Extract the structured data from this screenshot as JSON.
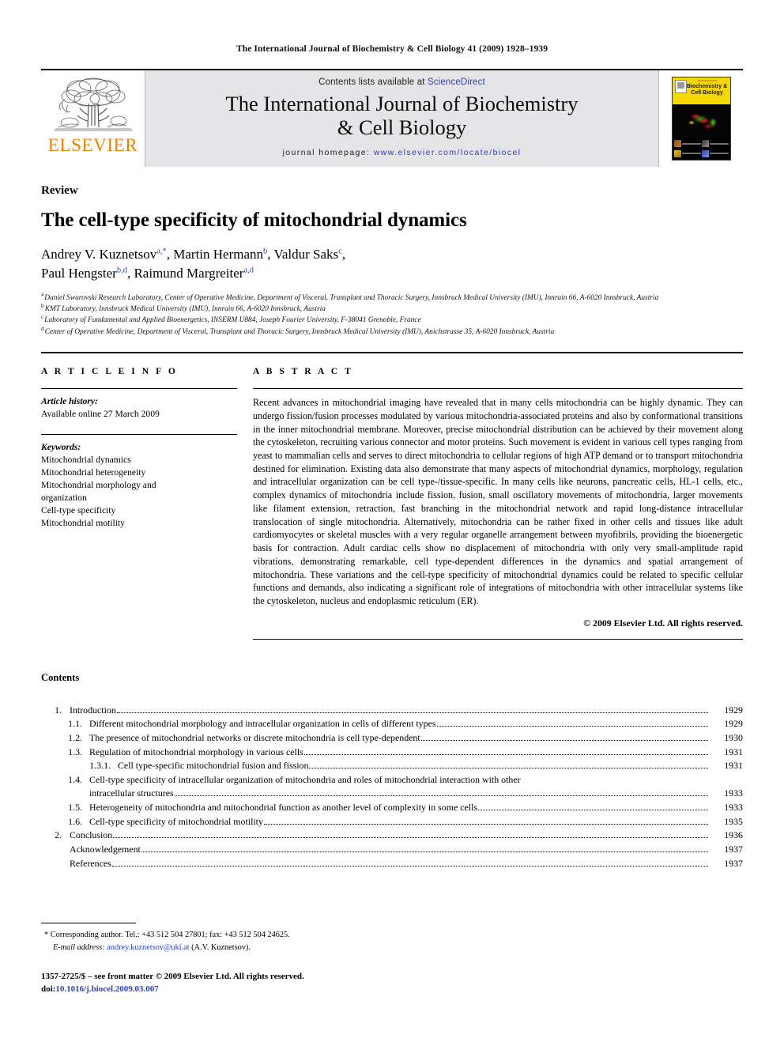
{
  "running_head": "The International Journal of Biochemistry & Cell Biology 41 (2009) 1928–1939",
  "masthead": {
    "publisher_name": "ELSEVIER",
    "contents_prefix": "Contents lists available at ",
    "sciencedirect": "ScienceDirect",
    "journal_title_line1": "The International Journal of Biochemistry",
    "journal_title_line2": "& Cell Biology",
    "homepage_prefix": "journal homepage: ",
    "homepage_url": "www.elsevier.com/locate/biocel",
    "cover": {
      "tiny_line": "The International Journal of",
      "title_line1": "Biochemistry &",
      "title_line2": "Cell Biology"
    },
    "colors": {
      "masthead_bg": "#e5e5e7",
      "link_blue": "#2b3fbd",
      "elsevier_orange": "#f08000",
      "cover_band_yellow": "#f5d800"
    }
  },
  "article": {
    "doctype": "Review",
    "title": "The cell-type specificity of mitochondrial dynamics",
    "authors_line1": "Andrey V. Kuznetsov",
    "authors_line1_sup": "a,*",
    "authors_line1_b": ", Martin Hermann",
    "authors_line1_b_sup": "b",
    "authors_line1_c": ", Valdur Saks",
    "authors_line1_c_sup": "c",
    "authors_line1_end": ",",
    "authors_line2": "Paul Hengster",
    "authors_line2_sup": "b,d",
    "authors_line2_b": ", Raimund Margreiter",
    "authors_line2_b_sup": "a,d",
    "affiliations": [
      {
        "mark": "a",
        "text": "Daniel Swarovski Research Laboratory, Center of Operative Medicine, Department of Visceral, Transplant and Thoracic Surgery, Innsbruck Medical University (IMU), Innrain 66, A-6020 Innsbruck, Austria"
      },
      {
        "mark": "b",
        "text": "KMT Laboratory, Innsbruck Medical University (IMU), Innrain 66, A-6020 Innsbruck, Austria"
      },
      {
        "mark": "c",
        "text": "Laboratory of Fundamental and Applied Bioenergetics, INSERM U884, Joseph Fourier University, F-38041 Grenoble, France"
      },
      {
        "mark": "d",
        "text": "Center of Operative Medicine, Department of Visceral, Transplant and Thoracic Surgery, Innsbruck Medical University (IMU), Anichstrasse 35, A-6020 Innsbruck, Austria"
      }
    ]
  },
  "article_info": {
    "heading": "A R T I C L E    I N F O",
    "history_label": "Article history:",
    "history_value": "Available online 27 March 2009",
    "keywords_label": "Keywords:",
    "keywords": [
      "Mitochondrial dynamics",
      "Mitochondrial heterogeneity",
      "Mitochondrial morphology and\norganization",
      "Cell-type specificity",
      "Mitochondrial motility"
    ]
  },
  "abstract": {
    "heading": "A B S T R A C T",
    "text": "Recent advances in mitochondrial imaging have revealed that in many cells mitochondria can be highly dynamic. They can undergo fission/fusion processes modulated by various mitochondria-associated proteins and also by conformational transitions in the inner mitochondrial membrane. Moreover, precise mitochondrial distribution can be achieved by their movement along the cytoskeleton, recruiting various connector and motor proteins. Such movement is evident in various cell types ranging from yeast to mammalian cells and serves to direct mitochondria to cellular regions of high ATP demand or to transport mitochondria destined for elimination. Existing data also demonstrate that many aspects of mitochondrial dynamics, morphology, regulation and intracellular organization can be cell type-/tissue-specific. In many cells like neurons, pancreatic cells, HL-1 cells, etc., complex dynamics of mitochondria include fission, fusion, small oscillatory movements of mitochondria, larger movements like filament extension, retraction, fast branching in the mitochondrial network and rapid long-distance intracellular translocation of single mitochondria. Alternatively, mitochondria can be rather fixed in other cells and tissues like adult cardiomyocytes or skeletal muscles with a very regular organelle arrangement between myofibrils, providing the bioenergetic basis for contraction. Adult cardiac cells show no displacement of mitochondria with only very small-amplitude rapid vibrations, demonstrating remarkable, cell type-dependent differences in the dynamics and spatial arrangement of mitochondria. These variations and the cell-type specificity of mitochondrial dynamics could be related to specific cellular functions and demands, also indicating a significant role of integrations of mitochondria with other intracellular systems like the cytoskeleton, nucleus and endoplasmic reticulum (ER).",
    "copyright": "© 2009 Elsevier Ltd. All rights reserved."
  },
  "contents": {
    "heading": "Contents",
    "entries": [
      {
        "level": 1,
        "num": "1.",
        "text": "Introduction",
        "page": "1929"
      },
      {
        "level": 2,
        "num": "1.1.",
        "text": "Different mitochondrial morphology and intracellular organization in cells of different types",
        "page": "1929"
      },
      {
        "level": 2,
        "num": "1.2.",
        "text": "The presence of mitochondrial networks or discrete mitochondria is cell type-dependent",
        "page": "1930"
      },
      {
        "level": 2,
        "num": "1.3.",
        "text": "Regulation of mitochondrial morphology in various cells",
        "page": "1931"
      },
      {
        "level": 3,
        "num": "1.3.1.",
        "text": "Cell type-specific mitochondrial fusion and fission",
        "page": "1931"
      },
      {
        "level": 2,
        "num": "1.4.",
        "text": "Cell-type specificity of intracellular organization of mitochondria and roles of mitochondrial interaction with other",
        "text2": "intracellular structures",
        "page": "1933",
        "wrapped": true
      },
      {
        "level": 2,
        "num": "1.5.",
        "text": "Heterogeneity of mitochondria and mitochondrial function as another level of complexity in some cells",
        "page": "1933"
      },
      {
        "level": 2,
        "num": "1.6.",
        "text": "Cell-type specificity of mitochondrial motility",
        "page": "1935"
      },
      {
        "level": 1,
        "num": "2.",
        "text": "Conclusion",
        "page": "1936"
      },
      {
        "level": 1,
        "num": "",
        "text": "Acknowledgement",
        "page": "1937"
      },
      {
        "level": 1,
        "num": "",
        "text": "References",
        "page": "1937"
      }
    ]
  },
  "footer": {
    "corresponding_marker": "*",
    "corresponding_text": "Corresponding author. Tel.: +43 512 504 27801; fax: +43 512 504 24625.",
    "email_label": "E-mail address:",
    "email": "andrey.kuznetsov@uki.at",
    "email_suffix": " (A.V. Kuznetsov).",
    "issn_line": "1357-2725/$ – see front matter © 2009 Elsevier Ltd. All rights reserved.",
    "doi_label": "doi:",
    "doi_value": "10.1016/j.biocel.2009.03.007"
  }
}
